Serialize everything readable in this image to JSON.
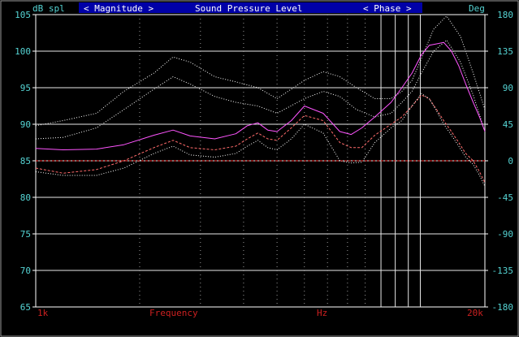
{
  "header": {
    "left_unit": "dB spl",
    "left_button": "< Magnitude >",
    "title": "Sound Pressure Level",
    "right_button": "< Phase >",
    "right_unit": "Deg"
  },
  "colors": {
    "background": "#000000",
    "frame": "#ffffff",
    "title_bar": "#0000a8",
    "title_text": "#ffffff",
    "cyan": "#55d4d4",
    "red_label": "#cc2020",
    "grid": "#e8e8e8",
    "minor_grid": "#9a9a9a"
  },
  "chart_data": {
    "type": "line",
    "title": "Sound Pressure Level",
    "ylabel": "dB spl",
    "y2label": "Deg",
    "xlabel": "Frequency",
    "xunit_label": "Hz",
    "x_scale": "log",
    "xlim": [
      1000,
      20000
    ],
    "ylim": [
      65,
      105
    ],
    "y2lim": [
      -180,
      180
    ],
    "x_tick_labels": [
      {
        "x": 1000,
        "label": "1k"
      },
      {
        "x": 20000,
        "label": "20k"
      }
    ],
    "y_ticks": [
      65,
      70,
      75,
      80,
      85,
      90,
      95,
      100,
      105
    ],
    "y2_ticks": [
      -180,
      -135,
      -90,
      -45,
      0,
      45,
      90,
      135,
      180
    ],
    "grid": true,
    "series": [
      {
        "color": "#ffffff",
        "style": "dotted",
        "x": [
          1000,
          1200,
          1500,
          1800,
          2200,
          2500,
          2800,
          3300,
          3800,
          4400,
          5000,
          6000,
          6800,
          7600,
          8500,
          9600,
          10700,
          11500,
          12300,
          13100,
          14200,
          15500,
          17000,
          18500,
          20000
        ],
        "y": [
          89.8,
          90.5,
          91.5,
          94.5,
          97.0,
          99.2,
          98.5,
          96.5,
          95.8,
          95.0,
          93.5,
          96.0,
          97.2,
          96.5,
          95.0,
          93.5,
          93.5,
          94.5,
          96.0,
          99.0,
          103.0,
          104.8,
          102.0,
          97.0,
          92.0
        ]
      },
      {
        "color": "#ffffff",
        "style": "dotted",
        "x": [
          1000,
          1200,
          1500,
          1800,
          2200,
          2500,
          2800,
          3300,
          3800,
          4400,
          5000,
          6000,
          6800,
          7600,
          8500,
          9600,
          10700,
          11500,
          12300,
          13100,
          14200,
          15500,
          17000,
          18500,
          20000
        ],
        "y": [
          88.0,
          88.2,
          89.5,
          92.0,
          94.8,
          96.5,
          95.5,
          93.8,
          93.0,
          92.5,
          91.5,
          93.5,
          94.5,
          93.8,
          92.0,
          91.0,
          91.5,
          93.0,
          94.5,
          97.0,
          100.0,
          101.5,
          98.5,
          94.0,
          89.0
        ]
      },
      {
        "color": "#ff55ff",
        "style": "solid",
        "x": [
          1000,
          1200,
          1500,
          1800,
          2200,
          2500,
          2800,
          3300,
          3800,
          4100,
          4400,
          4700,
          5000,
          5500,
          6000,
          6800,
          7600,
          8200,
          8800,
          9600,
          10700,
          11500,
          12300,
          13100,
          13800,
          14500,
          15200,
          16000,
          16800,
          17600,
          18500,
          19300,
          20000
        ],
        "y": [
          86.7,
          86.5,
          86.6,
          87.2,
          88.5,
          89.2,
          88.4,
          88.0,
          88.7,
          89.8,
          90.2,
          89.2,
          89.0,
          90.5,
          92.5,
          91.5,
          89.0,
          88.6,
          89.5,
          91.0,
          93.0,
          95.0,
          97.0,
          99.5,
          100.8,
          101.0,
          101.2,
          100.0,
          98.0,
          95.5,
          93.0,
          91.0,
          89.0
        ]
      },
      {
        "color": "#ff6b6b",
        "style": "dashed",
        "x": [
          1000,
          1200,
          1500,
          1800,
          2200,
          2500,
          2800,
          3300,
          3800,
          4100,
          4400,
          4700,
          5000,
          5500,
          6000,
          6800,
          7600,
          8200,
          8800,
          9600,
          10700,
          11500,
          12300,
          13100,
          13800,
          14500,
          15200,
          16000,
          16800,
          17600,
          18500,
          19300,
          20000
        ],
        "y": [
          84.0,
          83.3,
          83.8,
          85.0,
          86.8,
          87.8,
          86.8,
          86.5,
          87.0,
          88.0,
          88.8,
          88.0,
          87.8,
          89.5,
          91.2,
          90.5,
          87.5,
          86.8,
          86.8,
          88.5,
          90.0,
          91.0,
          92.5,
          94.0,
          93.5,
          92.0,
          90.5,
          89.0,
          87.5,
          86.0,
          85.0,
          83.5,
          82.0
        ]
      },
      {
        "color": "#ffffff",
        "style": "dotted",
        "x": [
          1000,
          1200,
          1500,
          1800,
          2200,
          2500,
          2800,
          3300,
          3800,
          4100,
          4400,
          4700,
          5000,
          5500,
          6000,
          6800,
          7600,
          8200,
          8800,
          9600,
          10700,
          11500,
          12300,
          13100,
          13800,
          14500,
          15200,
          16000,
          16800,
          17600,
          18500,
          19300,
          20000
        ],
        "y": [
          83.5,
          83.0,
          83.0,
          84.0,
          86.0,
          87.0,
          85.8,
          85.5,
          86.0,
          87.0,
          87.8,
          86.8,
          86.5,
          88.0,
          90.0,
          88.8,
          85.0,
          84.7,
          84.8,
          87.5,
          89.5,
          90.5,
          92.5,
          94.2,
          93.5,
          91.8,
          90.0,
          88.5,
          87.0,
          85.5,
          84.5,
          83.0,
          81.5
        ]
      },
      {
        "color": "#ff3030",
        "style": "dashed",
        "x": [
          1000,
          20000
        ],
        "y": [
          85.0,
          85.0
        ]
      }
    ]
  }
}
